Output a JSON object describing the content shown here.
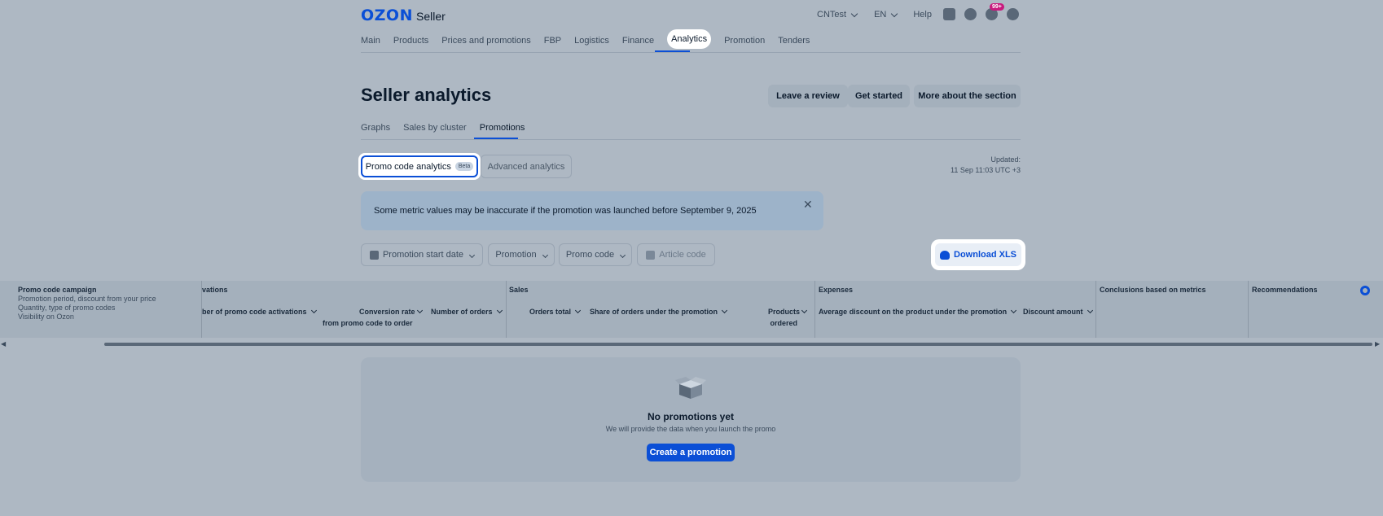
{
  "header": {
    "logo_brand": "OZON",
    "logo_product": "Seller",
    "account": "CNTest",
    "language": "EN",
    "help": "Help",
    "notifications_badge": "99+"
  },
  "nav": {
    "items": [
      "Main",
      "Products",
      "Prices and promotions",
      "FBP",
      "Logistics",
      "Finance",
      "Analytics",
      "Promotion",
      "Tenders"
    ],
    "active": "Analytics"
  },
  "page": {
    "title": "Seller analytics",
    "leave_review": "Leave a review",
    "get_started": "Get started",
    "more_about": "More about the section"
  },
  "tabs": {
    "items": [
      "Graphs",
      "Sales by cluster",
      "Promotions"
    ],
    "active": "Promotions"
  },
  "segment": {
    "promo_code": "Promo code analytics",
    "beta": "Beta",
    "advanced": "Advanced analytics"
  },
  "updated": {
    "label": "Updated:",
    "value": "11 Sep 11:03 UTC +3"
  },
  "alert": {
    "text": "Some metric values may be inaccurate if the promotion was launched before September 9, 2025",
    "close": "✕"
  },
  "filters": {
    "start_date": "Promotion start date",
    "promotion": "Promotion",
    "promo_code": "Promo code",
    "article_code": "Article code",
    "download": "Download XLS"
  },
  "table": {
    "campaign_header": "Promo code campaign",
    "campaign_sub": [
      "Promotion period, discount from your price",
      "Quantity, type of promo codes",
      "Visibility on Ozon"
    ],
    "groups": {
      "activations": "vations",
      "sales": "Sales",
      "expenses": "Expenses",
      "conclusions": "Conclusions based on metrics",
      "recommendations": "Recommendations"
    },
    "columns": {
      "activations_count": "ber of promo code activations",
      "conversion_rate_1": "Conversion rate",
      "conversion_rate_2": "from promo code to order",
      "num_orders": "Number of orders",
      "orders_total": "Orders total",
      "share_orders": "Share of orders under the promotion",
      "products_ordered_1": "Products",
      "products_ordered_2": "ordered",
      "avg_discount": "Average discount on the product under the promotion",
      "discount_amount": "Discount amount"
    }
  },
  "empty": {
    "title": "No promotions yet",
    "subtitle": "We will provide the data when you launch the promo",
    "button": "Create a promotion"
  },
  "colors": {
    "accent": "#0b4fd6",
    "background": "#aeb8c3",
    "badge": "#c8197d"
  }
}
